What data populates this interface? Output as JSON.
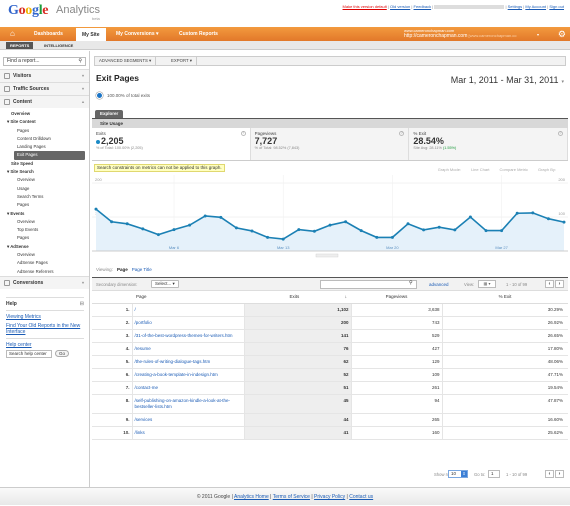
{
  "app": {
    "logo_word": "Google",
    "product": "Analytics",
    "badge": "beta"
  },
  "top_links": {
    "make_default": "Make this version default",
    "old_version": "Old version",
    "feedback": "Feedback",
    "settings": "Settings",
    "my_account": "My Account",
    "sign_out": "Sign out"
  },
  "nav": {
    "home_icon": "home-icon",
    "tabs": [
      {
        "label": "Dashboards"
      },
      {
        "label": "My Site"
      },
      {
        "label": "My Conversions ▾"
      },
      {
        "label": "Custom Reports"
      }
    ]
  },
  "account": {
    "line1": "www.cameronchapman.com",
    "line2": "http://cameronchapman.com",
    "line2_dim": "[www.cameronchapman.co"
  },
  "subtabs": {
    "reports": "REPORTS",
    "intelligence": "INTELLIGENCE"
  },
  "sidebar": {
    "find_placeholder": "Find a report...",
    "sections": [
      {
        "label": "Visitors"
      },
      {
        "label": "Traffic Sources"
      },
      {
        "label": "Content"
      }
    ],
    "content_items": [
      {
        "label": "Overview",
        "level": 1
      },
      {
        "label": "▾ Site Content",
        "level": 0
      },
      {
        "label": "Pages",
        "level": 2
      },
      {
        "label": "Content Drilldown",
        "level": 2
      },
      {
        "label": "Landing Pages",
        "level": 2
      },
      {
        "label": "Exit Pages",
        "level": 2,
        "selected": true
      },
      {
        "label": "Site Speed",
        "level": 1
      },
      {
        "label": "▾ Site Search",
        "level": 0
      },
      {
        "label": "Overview",
        "level": 2
      },
      {
        "label": "Usage",
        "level": 2
      },
      {
        "label": "Search Terms",
        "level": 2
      },
      {
        "label": "Pages",
        "level": 2
      },
      {
        "label": "▾ Events",
        "level": 0
      },
      {
        "label": "Overview",
        "level": 2
      },
      {
        "label": "Top Events",
        "level": 2
      },
      {
        "label": "Pages",
        "level": 2
      },
      {
        "label": "▾ AdSense",
        "level": 0
      },
      {
        "label": "Overview",
        "level": 2
      },
      {
        "label": "AdSense Pages",
        "level": 2
      },
      {
        "label": "AdSense Referrers",
        "level": 2
      }
    ],
    "conversions": "Conversions",
    "help": {
      "title": "Help",
      "link1": "Viewing Metrics",
      "link2": "Find Your Old Reports in the New Interface",
      "center": "Help center",
      "search_placeholder": "Search help center",
      "go": "Go"
    }
  },
  "toolbar": {
    "segments": "ADVANCED SEGMENTS ▾",
    "export": "EXPORT ▾"
  },
  "page": {
    "title": "Exit Pages",
    "date_range": "Mar 1, 2011 - Mar 31, 2011",
    "segment_pct": "100.00% of total exits"
  },
  "explorer": {
    "tab": "Explorer",
    "subtab": "Site Usage"
  },
  "metrics": [
    {
      "label": "Exits",
      "value": "2,205",
      "sub": "% of Total: 100.00% (2,205)"
    },
    {
      "label": "Pageviews",
      "value": "7,727",
      "sub": "% of Total: 98.52% (7,843)"
    },
    {
      "label": "% Exit",
      "value": "28.54%",
      "sub": "Site Avg: 28.11%",
      "sub_delta": "(1.55%)"
    }
  ],
  "warning": "Search constraints on metrics can not be applied to this graph.",
  "graph_options": [
    "Graph Mode:",
    "Line Chart",
    "Compare Metric",
    "Graph By:"
  ],
  "chart_data": {
    "type": "line",
    "series": [
      {
        "name": "Exits",
        "values": [
          123,
          86,
          80,
          65,
          48,
          63,
          76,
          103,
          99,
          68,
          59,
          40,
          35,
          63,
          58,
          76,
          86,
          60,
          40,
          40,
          80,
          62,
          70,
          62,
          100,
          60,
          60,
          111,
          112,
          95,
          85
        ]
      }
    ],
    "x_tick_labels": [
      "Mar 6",
      "Mar 13",
      "Mar 20",
      "Mar 27"
    ],
    "y_tick_labels": [
      "200",
      "100"
    ],
    "ylim": [
      0,
      200
    ],
    "color": "#1b80b4"
  },
  "viewing": {
    "label": "Viewing:",
    "page": "Page",
    "page_title": "Page Title"
  },
  "table_bar": {
    "secondary": "Secondary dimension:",
    "select": "Select... ▾",
    "advanced": "advanced",
    "view": "View:",
    "range": "1 - 10 of 99"
  },
  "table": {
    "headers": {
      "page": "Page",
      "exits": "Exits",
      "pageviews": "Pageviews",
      "pct_exit": "% Exit"
    },
    "rows": [
      {
        "n": "1.",
        "page": "/",
        "exits": "1,102",
        "pageviews": "3,638",
        "pct": "30.29%"
      },
      {
        "n": "2.",
        "page": "/portfolio",
        "exits": "200",
        "pageviews": "743",
        "pct": "26.92%"
      },
      {
        "n": "3.",
        "page": "/31-of-the-best-wordpress-themes-for-writers.htm",
        "exits": "141",
        "pageviews": "529",
        "pct": "26.65%"
      },
      {
        "n": "4.",
        "page": "/resume",
        "exits": "76",
        "pageviews": "427",
        "pct": "17.80%"
      },
      {
        "n": "5.",
        "page": "/the-rules-of-writing-dialogue-tags.htm",
        "exits": "62",
        "pageviews": "129",
        "pct": "48.06%"
      },
      {
        "n": "6.",
        "page": "/creating-a-book-template-in-indesign.htm",
        "exits": "52",
        "pageviews": "109",
        "pct": "47.71%"
      },
      {
        "n": "7.",
        "page": "/contact-me",
        "exits": "51",
        "pageviews": "261",
        "pct": "19.54%"
      },
      {
        "n": "8.",
        "page": "/self-publishing-on-amazon-kindle-a-look-at-the-bestseller-lists.htm",
        "exits": "45",
        "pageviews": "94",
        "pct": "47.87%"
      },
      {
        "n": "9.",
        "page": "/services",
        "exits": "44",
        "pageviews": "265",
        "pct": "16.60%"
      },
      {
        "n": "10.",
        "page": "/links",
        "exits": "41",
        "pageviews": "160",
        "pct": "25.62%"
      }
    ]
  },
  "pagination": {
    "show_rows": "Show rows:",
    "rows": "10",
    "goto": "Go to:",
    "goto_val": "1",
    "range": "1 - 10 of 99"
  },
  "footer": {
    "copyright": "© 2011 Google",
    "analytics_home": "Analytics Home",
    "terms": "Terms of Service",
    "privacy": "Privacy Policy",
    "contact": "Contact us"
  }
}
